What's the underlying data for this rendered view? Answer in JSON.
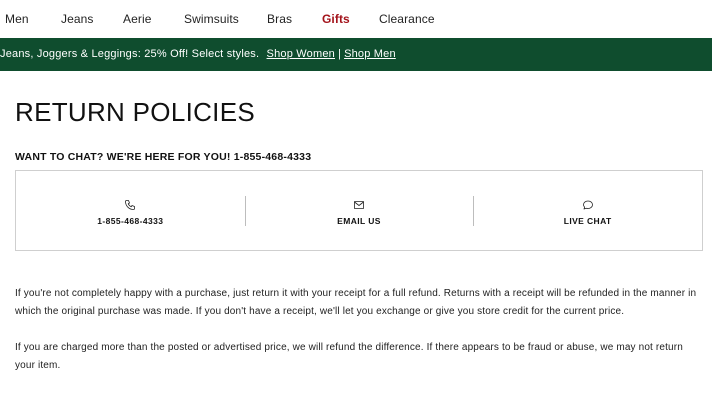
{
  "nav": {
    "items": [
      "Men",
      "Jeans",
      "Aerie",
      "Swimsuits",
      "Bras",
      "Gifts",
      "Clearance"
    ]
  },
  "promo": {
    "text": "Jeans, Joggers & Leggings: 25% Off! Select styles.",
    "link_women": "Shop Women",
    "separator": "|",
    "link_men": "Shop Men",
    "background": "#0f4d2e"
  },
  "page": {
    "title": "RETURN POLICIES",
    "chat_heading": "WANT TO CHAT? WE'RE HERE FOR YOU! 1-855-468-4333"
  },
  "contact": {
    "phone_label": "1-855-468-4333",
    "email_label": "EMAIL US",
    "chat_label": "LIVE CHAT",
    "icons": [
      "phone-icon",
      "mail-icon",
      "chat-bubble-icon"
    ]
  },
  "policy": {
    "para1": "If you're not completely happy with a purchase, just return it with your receipt for a full refund.  Returns with a receipt will be refunded in the manner in which the original purchase was made.  If you don't have a receipt, we'll let you exchange or give you store credit for the current price.",
    "para2": "If you are charged more than the posted or advertised price, we will refund the difference.  If there appears to be fraud or abuse, we may not return your item."
  },
  "colors": {
    "accent_red": "#a3131b"
  }
}
